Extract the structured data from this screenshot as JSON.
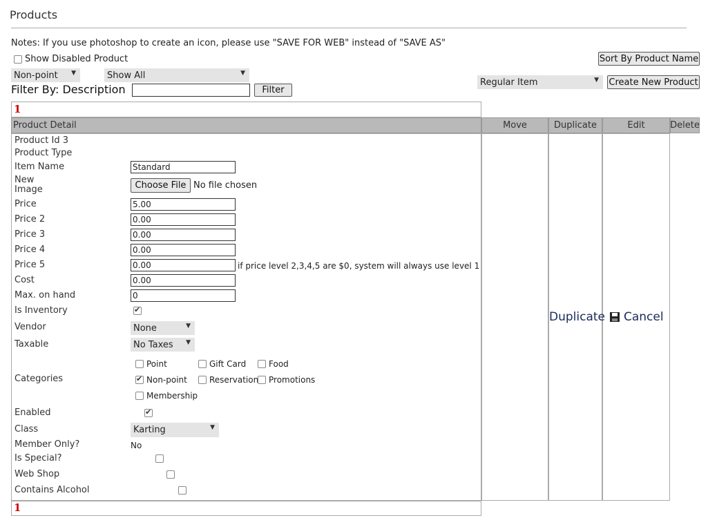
{
  "page": {
    "title": "Products",
    "notes": "Notes: If you use photoshop to create an icon, please use \"SAVE FOR WEB\" instead of \"SAVE AS\""
  },
  "filters": {
    "show_disabled_label": "Show Disabled Product",
    "point_select": "Non-point",
    "show_select": "Show All",
    "filter_by_label": "Filter By:",
    "filter_field_label": "Description",
    "filter_input_value": "",
    "filter_button": "Filter",
    "sort_button": "Sort By Product Name",
    "item_type_select": "Regular Item",
    "create_button": "Create New Product"
  },
  "pager": {
    "page": "1"
  },
  "table": {
    "headers": {
      "detail": "Product Detail",
      "move": "Move",
      "duplicate": "Duplicate",
      "edit": "Edit",
      "delete": "Delete"
    },
    "actions": {
      "duplicate": "Duplicate",
      "cancel": "Cancel"
    }
  },
  "product": {
    "id_line": "Product Id 3",
    "type_label": "Product Type",
    "item_name_label": "Item Name",
    "item_name": "Standard",
    "new_image_label_1": "New",
    "new_image_label_2": "Image",
    "choose_file": "Choose File",
    "no_file": "No file chosen",
    "price_label": "Price",
    "price": "5.00",
    "price2_label": "Price 2",
    "price2": "0.00",
    "price3_label": "Price 3",
    "price3": "0.00",
    "price4_label": "Price 4",
    "price4": "0.00",
    "price5_label": "Price 5",
    "price5": "0.00",
    "price_note": "if price level 2,3,4,5 are $0, system will always use level 1",
    "cost_label": "Cost",
    "cost": "0.00",
    "max_label": "Max. on hand",
    "max": "0",
    "inventory_label": "Is Inventory",
    "vendor_label": "Vendor",
    "vendor": "None",
    "taxable_label": "Taxable",
    "taxable": "No Taxes",
    "categories_label": "Categories",
    "categories": {
      "point": "Point",
      "gift_card": "Gift Card",
      "food": "Food",
      "non_point": "Non-point",
      "reservation": "Reservation",
      "promotions": "Promotions",
      "membership": "Membership"
    },
    "enabled_label": "Enabled",
    "class_label": "Class",
    "class": "Karting",
    "member_only_label": "Member Only?",
    "member_only": "No",
    "special_label": "Is Special?",
    "webshop_label": "Web Shop",
    "alcohol_label": "Contains Alcohol"
  }
}
